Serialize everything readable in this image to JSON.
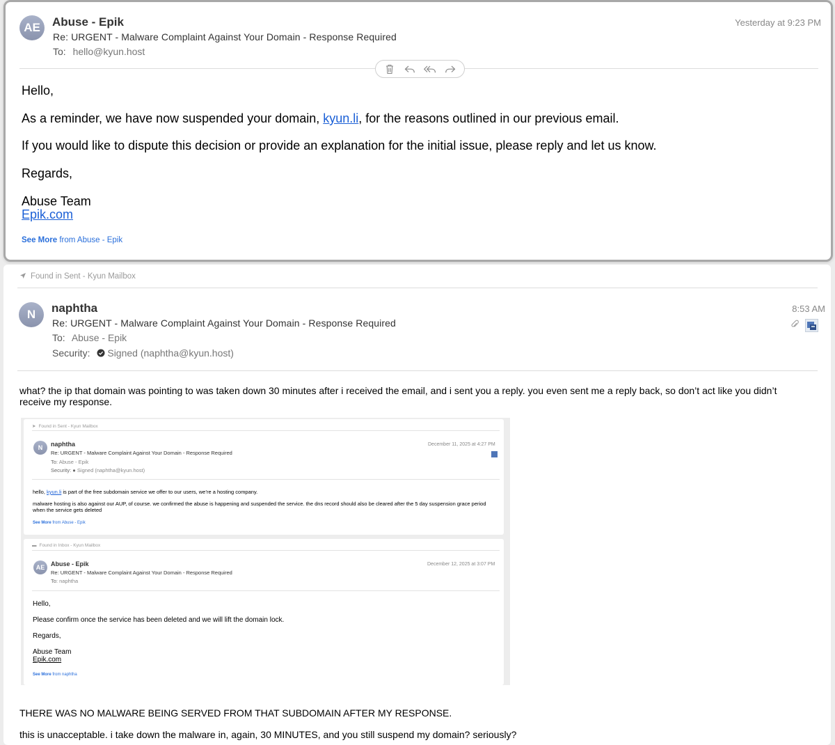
{
  "message1": {
    "avatar_initials": "AE",
    "sender": "Abuse - Epik",
    "subject": "Re: URGENT - Malware Complaint Against Your Domain - Response Required",
    "to_label": "To:",
    "to_value": "hello@kyun.host",
    "date": "Yesterday at 9:23 PM",
    "toolbar_icons": [
      "trash-icon",
      "reply-icon",
      "reply-all-icon",
      "forward-icon"
    ],
    "body": {
      "greeting": "Hello,",
      "line1_pre": "As a reminder, we have now suspended your domain, ",
      "line1_link": "kyun.li",
      "line1_post": ", for the reasons outlined in our previous email.",
      "line2": "If you would like to dispute this decision or provide an explanation for the initial issue, please reply and let us know.",
      "regards": "Regards,",
      "team": "Abuse Team",
      "site_link": "Epik.com"
    },
    "see_more_bold": "See More",
    "see_more_rest": " from Abuse - Epik"
  },
  "message2": {
    "found_in": "Found in Sent - Kyun Mailbox",
    "avatar_initials": "N",
    "sender": "naphtha",
    "subject": "Re: URGENT - Malware Complaint Against Your Domain - Response Required",
    "to_label": "To:",
    "to_value": "Abuse - Epik",
    "security_label": "Security:",
    "security_value": "Signed (naphtha@kyun.host)",
    "time": "8:53 AM",
    "body_line1": "what? the ip that domain was pointing to was taken down 30 minutes after i received the email, and i sent you a reply. you even sent me a reply back, so don’t act like you didn’t receive my response.",
    "body_line2": "THERE WAS NO MALWARE BEING SERVED FROM THAT SUBDOMAIN AFTER MY RESPONSE.",
    "body_line3": "this is unacceptable. i take down the malware in, again, 30 MINUTES, and you still suspend my domain? seriously?"
  },
  "embedded": {
    "card1": {
      "found_in": "Found in Sent - Kyun Mailbox",
      "avatar_initials": "N",
      "sender": "naphtha",
      "subject": "Re: URGENT - Malware Complaint Against Your Domain - Response Required",
      "to_label": "To:",
      "to_value": "Abuse - Epik",
      "security_label": "Security:",
      "security_value": "Signed (naphtha@kyun.host)",
      "date": "December 11, 2025 at 4:27 PM",
      "body_pre": "hello, ",
      "body_link": "kyun.li",
      "body_post": " is part of the free subdomain service we offer to our users, we’re a hosting company.",
      "body2": "malware hosting is also against our AUP, of course. we confirmed the abuse is happening and suspended the service. the dns record should also be cleared after the 5 day suspension grace period when the service gets deleted",
      "see_more_bold": "See More",
      "see_more_rest": " from Abuse - Epik"
    },
    "card2": {
      "found_in": "Found in Inbox - Kyun Mailbox",
      "avatar_initials": "AE",
      "sender": "Abuse - Epik",
      "subject": "Re: URGENT - Malware Complaint Against Your Domain - Response Required",
      "to_label": "To:",
      "to_value": "naphtha",
      "date": "December 12, 2025 at 3:07 PM",
      "greeting": "Hello,",
      "line1": "Please confirm once the service has been deleted and we will lift the domain lock.",
      "regards": "Regards,",
      "team": "Abuse Team",
      "site_link": "Epik.com",
      "see_more_bold": "See More",
      "see_more_rest": " from naphtha"
    }
  }
}
